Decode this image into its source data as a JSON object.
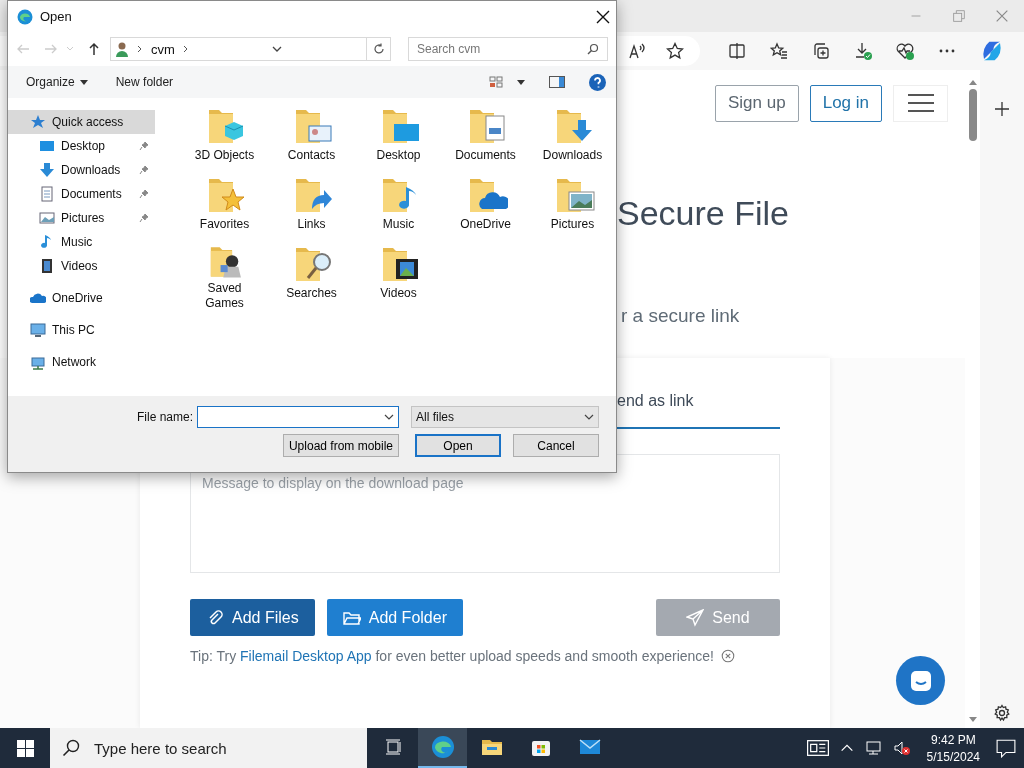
{
  "dialog": {
    "title": "Open",
    "path": [
      "cvm"
    ],
    "search": {
      "placeholder": "Search cvm"
    },
    "commands": [
      "Organize",
      "New folder"
    ],
    "nav": [
      {
        "label": "Quick access",
        "selected": true,
        "children": [
          {
            "label": "Desktop",
            "selected": false,
            "pinned": true
          },
          {
            "label": "Downloads",
            "selected": false,
            "pinned": true
          },
          {
            "label": "Documents",
            "selected": false,
            "pinned": true
          },
          {
            "label": "Pictures",
            "selected": false,
            "pinned": true
          },
          {
            "label": "Music",
            "selected": false,
            "pinned": false
          },
          {
            "label": "Videos",
            "selected": false,
            "pinned": false
          }
        ]
      },
      {
        "label": "OneDrive",
        "selected": false
      },
      {
        "label": "This PC",
        "selected": false
      },
      {
        "label": "Network",
        "selected": false
      }
    ],
    "items": [
      {
        "label": "3D Objects"
      },
      {
        "label": "Contacts"
      },
      {
        "label": "Desktop"
      },
      {
        "label": "Documents"
      },
      {
        "label": "Downloads"
      },
      {
        "label": "Favorites"
      },
      {
        "label": "Links"
      },
      {
        "label": "Music"
      },
      {
        "label": "OneDrive"
      },
      {
        "label": "Pictures"
      },
      {
        "label": "Saved Games"
      },
      {
        "label": "Searches"
      },
      {
        "label": "Videos"
      }
    ],
    "file_name": {
      "label": "File name:"
    },
    "filter": "All files",
    "buttons": [
      {
        "label": "Upload from mobile",
        "default": false
      },
      {
        "label": "Open",
        "default": true
      },
      {
        "label": "Cancel",
        "default": false
      }
    ]
  },
  "page": {
    "header_buttons": [
      {
        "label": "Sign up",
        "kind": "plain"
      },
      {
        "label": "Log in",
        "kind": "accent"
      }
    ],
    "heading": "Secure File",
    "subheading": "r a secure link",
    "tab": {
      "label": "end as link",
      "selected": true
    },
    "message": {
      "placeholder": "Message to display on the download page"
    },
    "actions": [
      {
        "label": "Add Files",
        "kind": "files",
        "hovered": true,
        "disabled": false
      },
      {
        "label": "Add Folder",
        "kind": "folder",
        "hovered": false,
        "disabled": false
      },
      {
        "label": "Send",
        "kind": "send",
        "hovered": false,
        "disabled": true
      }
    ],
    "tip": {
      "prefix": "Tip: Try",
      "link": "Filemail Desktop App",
      "suffix": "for even better upload speeds and smooth experience!"
    }
  },
  "taskbar": {
    "search": {
      "placeholder": "Type here to search"
    },
    "apps": [
      {
        "selected": true
      },
      {
        "selected": false
      },
      {
        "selected": false
      },
      {
        "selected": false
      }
    ],
    "time": "9:42 PM",
    "date": "5/15/2024"
  }
}
